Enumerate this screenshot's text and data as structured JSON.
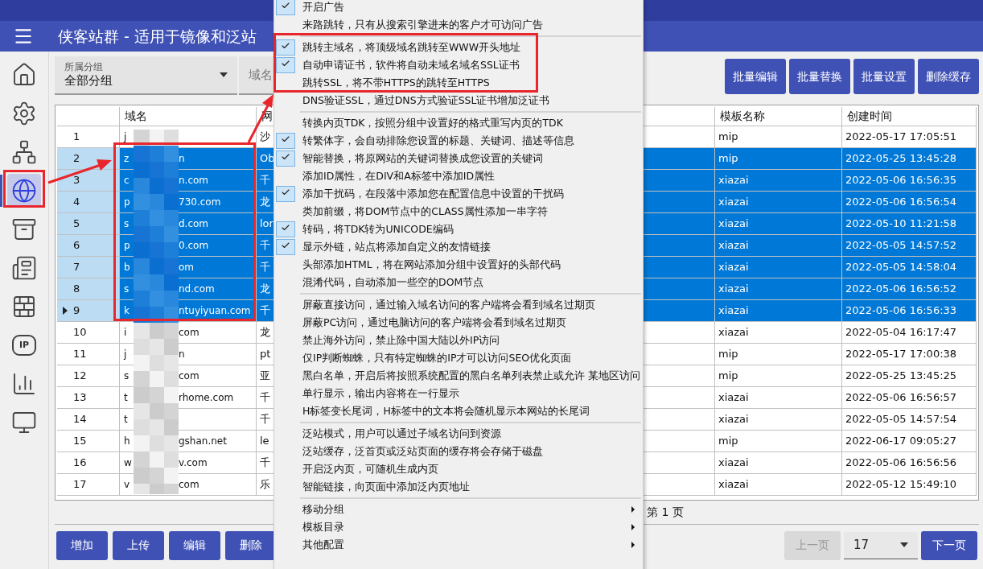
{
  "window": {
    "title": "侠客站群 - 适用于镜像和泛站"
  },
  "sidebar": {
    "items": [
      {
        "kind": "home",
        "selected": false
      },
      {
        "kind": "settings",
        "selected": false
      },
      {
        "kind": "network",
        "selected": false
      },
      {
        "kind": "globe",
        "selected": true
      },
      {
        "kind": "cabinet",
        "selected": false
      },
      {
        "kind": "newspaper",
        "selected": false
      },
      {
        "kind": "firewall",
        "selected": false
      },
      {
        "kind": "ip",
        "label": "IP",
        "selected": false
      },
      {
        "kind": "chart",
        "selected": false
      },
      {
        "kind": "monitor",
        "selected": false
      }
    ]
  },
  "toolbar": {
    "group_filter": {
      "label": "所属分组",
      "value": "全部分组"
    },
    "domain_filter": {
      "label": "域名"
    },
    "buttons": [
      "批量编辑",
      "批量替换",
      "批量设置",
      "删除缓存"
    ]
  },
  "table": {
    "columns": [
      "域名",
      "网",
      "模板名称",
      "创建时间"
    ],
    "rows": [
      {
        "number": "1",
        "domain_start": "j",
        "col3": "沙",
        "template": "mip",
        "created": "2022-05-17 17:05:51",
        "selected": false,
        "current": false
      },
      {
        "number": "2",
        "domain_start": "z",
        "domain_end": "n",
        "col3": "Ob",
        "template": "mip",
        "created": "2022-05-25 13:45:28",
        "selected": true,
        "current": false
      },
      {
        "number": "3",
        "domain_start": "c",
        "domain_end": "n.com",
        "col3": "千",
        "template": "xiazai",
        "created": "2022-05-06 16:56:35",
        "selected": true,
        "current": false
      },
      {
        "number": "4",
        "domain_start": "p",
        "domain_end": "730.com",
        "col3": "龙",
        "template": "xiazai",
        "created": "2022-05-06 16:56:54",
        "selected": true,
        "current": false
      },
      {
        "number": "5",
        "domain_start": "s",
        "domain_end": "d.com",
        "col3": "lor",
        "template": "xiazai",
        "created": "2022-05-10 11:21:58",
        "selected": true,
        "current": false
      },
      {
        "number": "6",
        "domain_start": "p",
        "domain_end": "0.com",
        "col3": "千",
        "template": "xiazai",
        "created": "2022-05-05 14:57:52",
        "selected": true,
        "current": false
      },
      {
        "number": "7",
        "domain_start": "b",
        "domain_end": "om",
        "col3": "千",
        "template": "xiazai",
        "created": "2022-05-05 14:58:04",
        "selected": true,
        "current": false
      },
      {
        "number": "8",
        "domain_start": "s",
        "domain_end": "nd.com",
        "col3": "龙",
        "template": "xiazai",
        "created": "2022-05-06 16:56:52",
        "selected": true,
        "current": false
      },
      {
        "number": "9",
        "domain_start": "k",
        "domain_end": "ntuyiyuan.com",
        "col3": "千",
        "template": "xiazai",
        "created": "2022-05-06 16:56:33",
        "selected": true,
        "current": true
      },
      {
        "number": "10",
        "domain_start": "i",
        "domain_end": "com",
        "col3": "龙",
        "template": "xiazai",
        "created": "2022-05-04 16:17:47",
        "selected": false,
        "current": false
      },
      {
        "number": "11",
        "domain_start": "j",
        "domain_end": "n",
        "col3": "pt",
        "template": "mip",
        "created": "2022-05-17 17:00:38",
        "selected": false,
        "current": false
      },
      {
        "number": "12",
        "domain_start": "s",
        "domain_end": "com",
        "col3": "亚",
        "template": "mip",
        "created": "2022-05-25 13:45:25",
        "selected": false,
        "current": false
      },
      {
        "number": "13",
        "domain_start": "t",
        "domain_end": "rhome.com",
        "col3": "千",
        "template": "xiazai",
        "created": "2022-05-06 16:56:57",
        "selected": false,
        "current": false
      },
      {
        "number": "14",
        "domain_start": "t",
        "col3": "千",
        "template": "xiazai",
        "created": "2022-05-05 14:57:54",
        "selected": false,
        "current": false
      },
      {
        "number": "15",
        "domain_start": "h",
        "domain_end": "gshan.net",
        "col3": "le",
        "template": "mip",
        "created": "2022-06-17 09:05:27",
        "selected": false,
        "current": false
      },
      {
        "number": "16",
        "domain_start": "w",
        "domain_end": "v.com",
        "col3": "千",
        "template": "xiazai",
        "created": "2022-05-06 16:56:56",
        "selected": false,
        "current": false
      },
      {
        "number": "17",
        "domain_start": "v",
        "domain_end": "com",
        "col3": "乐",
        "template": "xiazai",
        "created": "2022-05-12 15:49:10",
        "selected": false,
        "current": false
      }
    ]
  },
  "status": "第 1 页",
  "actions": [
    "增加",
    "上传",
    "编辑",
    "删除"
  ],
  "pagination": {
    "prev": {
      "label": "上一页",
      "disabled": true
    },
    "page_size": "17",
    "next": {
      "label": "下一页",
      "disabled": false
    }
  },
  "context_menu": {
    "groups": [
      [
        {
          "kind": "check",
          "label": "开启广告",
          "checked": true
        },
        {
          "kind": "check",
          "label": "来路跳转，只有从搜索引擎进来的客户才可访问广告",
          "checked": false
        }
      ],
      [
        {
          "kind": "check",
          "label": "跳转主域名，将顶级域名跳转至WWW开头地址",
          "checked": true
        },
        {
          "kind": "check",
          "label": "自动申请证书，软件将自动未域名域名SSL证书",
          "checked": true
        },
        {
          "kind": "check",
          "label": "跳转SSL，将不带HTTPS的跳转至HTTPS",
          "checked": false
        },
        {
          "kind": "check",
          "label": "DNS验证SSL，通过DNS方式验证SSL证书增加泛证书",
          "checked": false
        }
      ],
      [
        {
          "kind": "check",
          "label": "转换内页TDK，按照分组中设置好的格式重写内页的TDK",
          "checked": false
        },
        {
          "kind": "check",
          "label": "转繁体字，会自动排除您设置的标题、关键词、描述等信息",
          "checked": true
        },
        {
          "kind": "check",
          "label": "智能替换，将原网站的关键词替换成您设置的关键词",
          "checked": true
        },
        {
          "kind": "check",
          "label": "添加ID属性，在DIV和A标签中添加ID属性",
          "checked": false
        },
        {
          "kind": "check",
          "label": "添加干扰码，在段落中添加您在配置信息中设置的干扰码",
          "checked": true
        },
        {
          "kind": "check",
          "label": "类加前缀，将DOM节点中的CLASS属性添加一串字符",
          "checked": false
        },
        {
          "kind": "check",
          "label": "转码，将TDK转为UNICODE编码",
          "checked": true
        },
        {
          "kind": "check",
          "label": "显示外链，站点将添加自定义的友情链接",
          "checked": true
        },
        {
          "kind": "check",
          "label": "头部添加HTML，将在网站添加分组中设置好的头部代码",
          "checked": false
        },
        {
          "kind": "check",
          "label": "混淆代码，自动添加一些空的DOM节点",
          "checked": false
        }
      ],
      [
        {
          "kind": "check",
          "label": "屏蔽直接访问，通过输入域名访问的客户端将会看到域名过期页",
          "checked": false
        },
        {
          "kind": "check",
          "label": "屏蔽PC访问，通过电脑访问的客户端将会看到域名过期页",
          "checked": false
        },
        {
          "kind": "check",
          "label": "禁止海外访问，禁止除中国大陆以外IP访问",
          "checked": false
        },
        {
          "kind": "check",
          "label": "仅IP判断蜘蛛，只有特定蜘蛛的IP才可以访问SEO优化页面",
          "checked": false
        },
        {
          "kind": "check",
          "label": "黑白名单，开启后将按照系统配置的黑白名单列表禁止或允许 某地区访问",
          "checked": false
        },
        {
          "kind": "check",
          "label": "单行显示，输出内容将在一行显示",
          "checked": false
        },
        {
          "kind": "check",
          "label": "H标签变长尾词，H标签中的文本将会随机显示本网站的长尾词",
          "checked": false
        }
      ],
      [
        {
          "kind": "check",
          "label": "泛站模式，用户可以通过子域名访问到资源",
          "checked": false
        },
        {
          "kind": "check",
          "label": "泛站缓存，泛首页或泛站页面的缓存将会存储于磁盘",
          "checked": false
        },
        {
          "kind": "check",
          "label": "开启泛内页，可随机生成内页",
          "checked": false
        },
        {
          "kind": "check",
          "label": "智能链接，向页面中添加泛内页地址",
          "checked": false
        }
      ],
      [
        {
          "kind": "submenu",
          "label": "移动分组"
        },
        {
          "kind": "submenu",
          "label": "模板目录"
        },
        {
          "kind": "submenu",
          "label": "其他配置"
        }
      ]
    ]
  }
}
